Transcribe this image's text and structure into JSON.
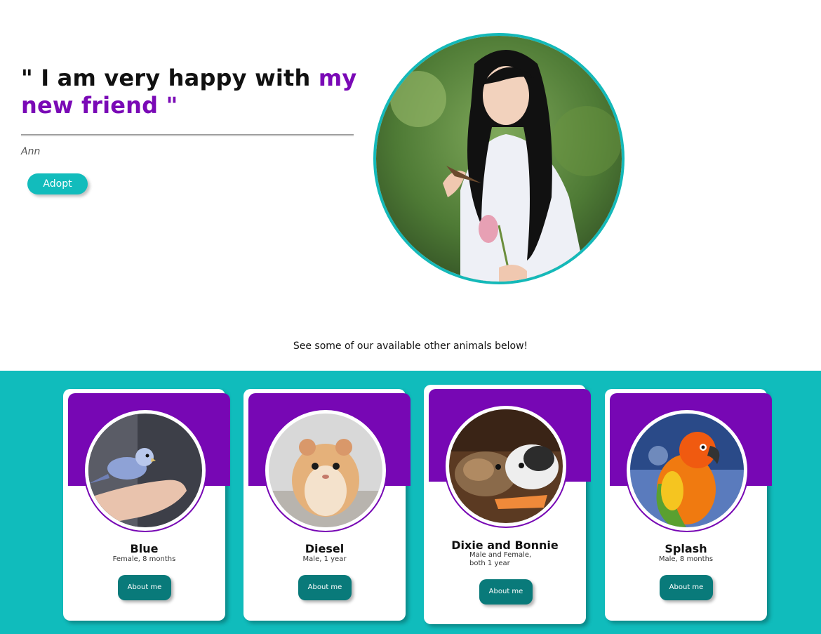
{
  "testimonial": {
    "quote_part1": "\" I am very happy with ",
    "quote_highlight": "my new friend \"",
    "author": "Ann",
    "adopt_label": "Adopt"
  },
  "intro_text": "See some of our available other animals below!",
  "colors": {
    "accent_teal": "#12bcbc",
    "accent_purple": "#7a09b6",
    "button_dark_teal": "#097a7a"
  },
  "animals": [
    {
      "name": "Blue",
      "description": "Female, 8 months",
      "button": "About me"
    },
    {
      "name": "Diesel",
      "description": "Male, 1 year",
      "button": "About me"
    },
    {
      "name": "Dixie and Bonnie",
      "description": "Male and Female, both 1 year",
      "button": "About me"
    },
    {
      "name": "Splash",
      "description": "Male, 8 months",
      "button": "About me"
    }
  ]
}
